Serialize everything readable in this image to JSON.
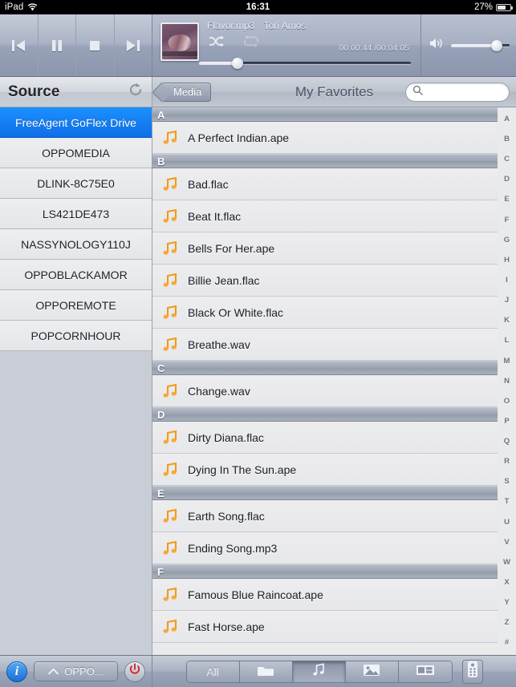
{
  "statusbar": {
    "device": "iPad",
    "wifi_icon": "wifi-icon",
    "time": "16:31",
    "battery_percent": "27%",
    "battery_icon": "battery-icon"
  },
  "player": {
    "prev_icon": "previous-track-icon",
    "pause_icon": "pause-icon",
    "stop_icon": "stop-icon",
    "next_icon": "next-track-icon",
    "album_art": "album-art-thumbnail",
    "track_title": "Flavor.mp3",
    "artist": "Tori Amos",
    "shuffle_icon": "shuffle-icon",
    "repeat_icon": "repeat-icon",
    "shuffle_active": true,
    "repeat_active": false,
    "elapsed": "00:00:44",
    "duration": "00:04:05",
    "timecode": "00:00:44 /00:04:05",
    "seek_percent": 18,
    "volume_icon": "volume-icon",
    "volume_percent": 78
  },
  "sidebar": {
    "header": "Source",
    "refresh_icon": "refresh-icon",
    "items": [
      {
        "label": "FreeAgent GoFlex Drive",
        "selected": true
      },
      {
        "label": "OPPOMEDIA",
        "selected": false
      },
      {
        "label": "DLINK-8C75E0",
        "selected": false
      },
      {
        "label": "LS421DE473",
        "selected": false
      },
      {
        "label": "NASSYNOLOGY110J",
        "selected": false
      },
      {
        "label": "OPPOBLACKAMOR",
        "selected": false
      },
      {
        "label": "OPPOREMOTE",
        "selected": false
      },
      {
        "label": "POPCORNHOUR",
        "selected": false
      }
    ]
  },
  "nav": {
    "back_label": "Media",
    "title": "My Favorites",
    "search_value": "",
    "search_placeholder": "",
    "search_icon": "search-icon"
  },
  "list": {
    "note_icon": "music-note-icon",
    "sections": [
      {
        "letter": "A",
        "tracks": [
          "A Perfect Indian.ape"
        ]
      },
      {
        "letter": "B",
        "tracks": [
          "Bad.flac",
          "Beat It.flac",
          "Bells For Her.ape",
          "Billie Jean.flac",
          "Black Or White.flac",
          "Breathe.wav"
        ]
      },
      {
        "letter": "C",
        "tracks": [
          "Change.wav"
        ]
      },
      {
        "letter": "D",
        "tracks": [
          "Dirty Diana.flac",
          "Dying In The Sun.ape"
        ]
      },
      {
        "letter": "E",
        "tracks": [
          "Earth Song.flac",
          "Ending Song.mp3"
        ]
      },
      {
        "letter": "F",
        "tracks": [
          "Famous Blue Raincoat.ape",
          "Fast Horse.ape"
        ]
      }
    ],
    "index": [
      "A",
      "B",
      "C",
      "D",
      "E",
      "F",
      "G",
      "H",
      "I",
      "J",
      "K",
      "L",
      "M",
      "N",
      "O",
      "P",
      "Q",
      "R",
      "S",
      "T",
      "U",
      "V",
      "W",
      "X",
      "Y",
      "Z",
      "#"
    ]
  },
  "toolbar": {
    "info_label": "i",
    "info_icon": "info-icon",
    "device_label": "OPPO...",
    "chevron_icon": "chevron-up-icon",
    "power_icon": "power-icon",
    "segments": [
      {
        "label": "All",
        "icon": "all-icon",
        "active": false
      },
      {
        "label": "",
        "icon": "folder-icon",
        "active": false
      },
      {
        "label": "",
        "icon": "music-icon",
        "active": true
      },
      {
        "label": "",
        "icon": "photo-icon",
        "active": false
      },
      {
        "label": "",
        "icon": "video-icon",
        "active": false
      }
    ],
    "remote_icon": "remote-control-icon"
  },
  "colors": {
    "selection_blue": "#1a90ff",
    "note_orange": "#f59a23",
    "power_red": "#d4272b",
    "info_blue": "#2b86e8"
  }
}
